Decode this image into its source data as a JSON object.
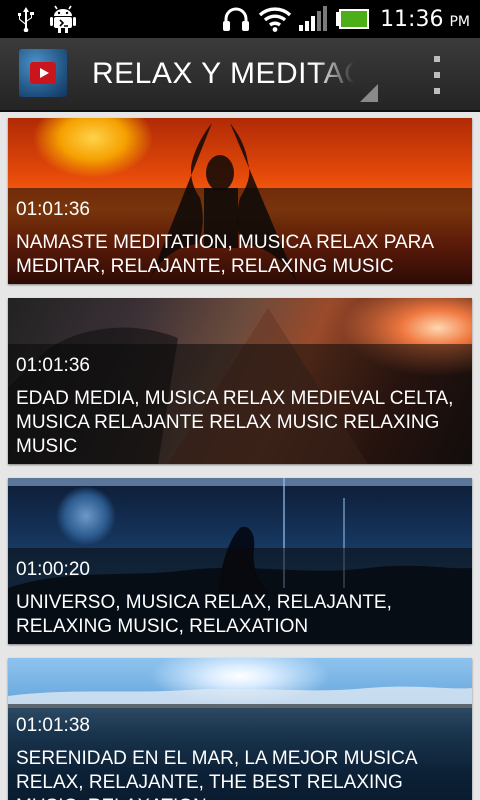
{
  "status_bar": {
    "time": "11:36",
    "ampm": "PM",
    "icons": [
      "usb-icon",
      "android-debug-icon",
      "headphones-icon",
      "wifi-icon",
      "signal-icon",
      "battery-icon"
    ],
    "battery_color": "#4caf1a"
  },
  "action_bar": {
    "title": "RELAX Y MEDITACIÓN",
    "app_icon": "play-video-icon",
    "menu_icon": "overflow-menu-icon"
  },
  "videos": [
    {
      "duration": "01:01:36",
      "title": "NAMASTE MEDITATION, MUSICA RELAX PARA MEDITAR, RELAJANTE, RELAXING MUSIC"
    },
    {
      "duration": "01:01:36",
      "title": "EDAD MEDIA, MUSICA RELAX MEDIEVAL CELTA, MUSICA RELAJANTE RELAX MUSIC RELAXING MUSIC"
    },
    {
      "duration": "01:00:20",
      "title": "UNIVERSO, MUSICA RELAX, RELAJANTE, RELAXING MUSIC, RELAXATION"
    },
    {
      "duration": "01:01:38",
      "title": "SERENIDAD EN EL MAR, LA MEJOR MUSICA RELAX, RELAJANTE, THE BEST RELAXING MUSIC, RELAXATION"
    }
  ]
}
